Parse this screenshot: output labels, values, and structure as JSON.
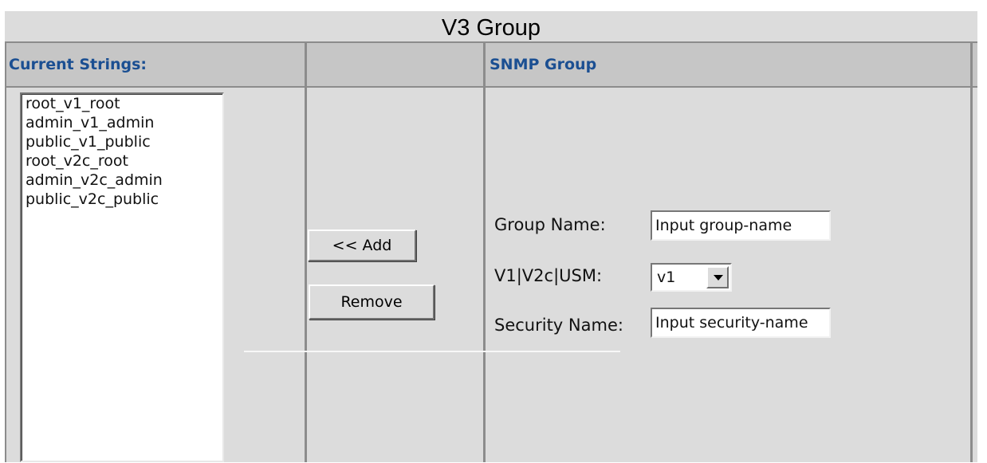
{
  "title": "V3 Group",
  "headers": {
    "current_strings": "Current Strings:",
    "middle": "",
    "snmp_group": "SNMP Group"
  },
  "current_strings": [
    "root_v1_root",
    "admin_v1_admin",
    "public_v1_public",
    "root_v2c_root",
    "admin_v2c_admin",
    "public_v2c_public"
  ],
  "buttons": {
    "add": "<< Add",
    "remove": "Remove"
  },
  "form": {
    "group_name_label": "Group Name:",
    "group_name_value": "Input group-name",
    "version_label": "V1|V2c|USM:",
    "version_value": "v1",
    "security_name_label": "Security Name:",
    "security_name_value": "Input security-name"
  },
  "icons": {
    "dropdown": "chevron-down-icon"
  }
}
